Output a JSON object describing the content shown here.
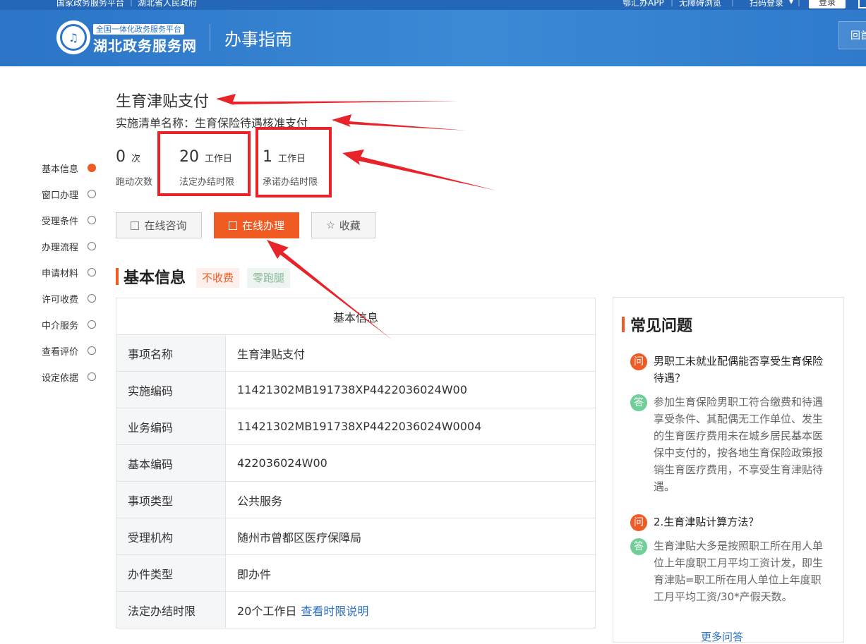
{
  "top_strip": {
    "left_link_1": "国家政务服务平台",
    "left_link_2": "湖北省人民政府",
    "app_link": "鄂汇办APP",
    "accessibility_link": "无障碍浏览",
    "scan_login": "扫码登录",
    "login_button": "登录"
  },
  "header": {
    "badge": "全国一体化政务服务平台",
    "site_name": "湖北政务服务网",
    "page_heading": "办事指南",
    "home_button": "回首"
  },
  "sidebar": {
    "items": [
      {
        "label": "基本信息",
        "active": true
      },
      {
        "label": "窗口办理",
        "active": false
      },
      {
        "label": "受理条件",
        "active": false
      },
      {
        "label": "办理流程",
        "active": false
      },
      {
        "label": "申请材料",
        "active": false
      },
      {
        "label": "许可收费",
        "active": false
      },
      {
        "label": "中介服务",
        "active": false
      },
      {
        "label": "查看评价",
        "active": false
      },
      {
        "label": "设定依据",
        "active": false
      }
    ]
  },
  "item": {
    "title": "生育津贴支付",
    "impl_name_label": "实施清单名称：",
    "impl_name": "生育保险待遇核准支付"
  },
  "stats": {
    "visits": {
      "num": "0",
      "unit": "次",
      "label": "跑动次数"
    },
    "legal_limit": {
      "num": "20",
      "unit": "工作日",
      "label": "法定办结时限"
    },
    "promise_limit": {
      "num": "1",
      "unit": "工作日",
      "label": "承诺办结时限"
    }
  },
  "actions": {
    "consult": "在线咨询",
    "online": "在线办理",
    "favorite": "收藏"
  },
  "section": {
    "title": "基本信息",
    "tag_fee": "不收费",
    "tag_zero": "零跑腿"
  },
  "table": {
    "header": "基本信息",
    "rows": [
      {
        "k": "事项名称",
        "v": "生育津贴支付"
      },
      {
        "k": "实施编码",
        "v": "11421302MB191738XP4422036024W00"
      },
      {
        "k": "业务编码",
        "v": "11421302MB191738XP4422036024W0004"
      },
      {
        "k": "基本编码",
        "v": "422036024W00"
      },
      {
        "k": "事项类型",
        "v": "公共服务"
      },
      {
        "k": "受理机构",
        "v": "随州市曾都区医疗保障局"
      },
      {
        "k": "办件类型",
        "v": "即办件"
      },
      {
        "k": "法定办结时限",
        "v": "20个工作日",
        "link": "查看时限说明"
      }
    ]
  },
  "faq": {
    "title": "常见问题",
    "q_badge": "问",
    "a_badge": "答",
    "items": [
      {
        "q": "男职工未就业配偶能否享受生育保险待遇？",
        "a": "参加生育保险男职工符合缴费和待遇享受条件、其配偶无工作单位、发生的生育医疗费用未在城乡居民基本医保中支付的，按各地生育保险政策报销生育医疗费用，不享受生育津贴待遇。"
      },
      {
        "q": "2.生育津贴计算方法？",
        "a": "生育津贴大多是按照职工所在用人单位上年度职工月平均工资计发，即生育津贴=职工所在用人单位上年度职工月平均工资/30*产假天数。"
      }
    ],
    "more": "更多问答"
  },
  "colors": {
    "header_blue": "#2b74c7",
    "accent_orange": "#f05a23",
    "annotation_red": "#e8232a"
  }
}
